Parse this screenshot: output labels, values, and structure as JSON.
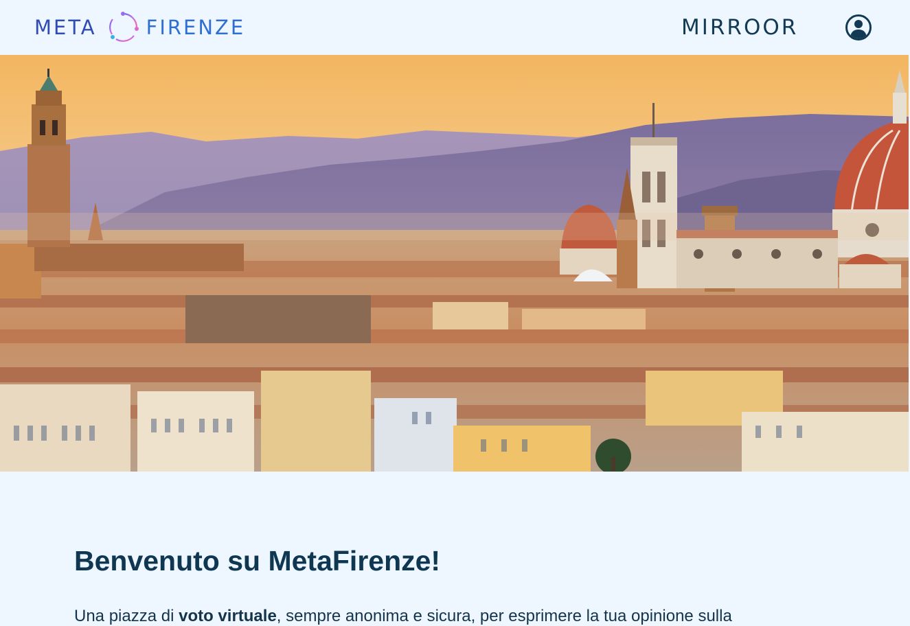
{
  "header": {
    "brand": {
      "left_word": "META",
      "right_word": "FIRENZE"
    },
    "partner": {
      "name": "MIRROOR"
    },
    "profile_icon": "user-circle-icon"
  },
  "hero": {
    "image": "florence-skyline-panorama"
  },
  "main": {
    "welcome_title": "Benvenuto su MetaFirenze!",
    "intro": {
      "part1": "Una piazza di ",
      "bold": "voto virtuale",
      "part2": ", sempre anonima e sicura, per esprimere la tua opinione sulla"
    }
  },
  "colors": {
    "page_bg": "#eef6ff",
    "title": "#0f3752",
    "brand_blue": "#2f4bb5",
    "partner_text": "#123a54",
    "partner_arc": "#3fa9e8"
  }
}
